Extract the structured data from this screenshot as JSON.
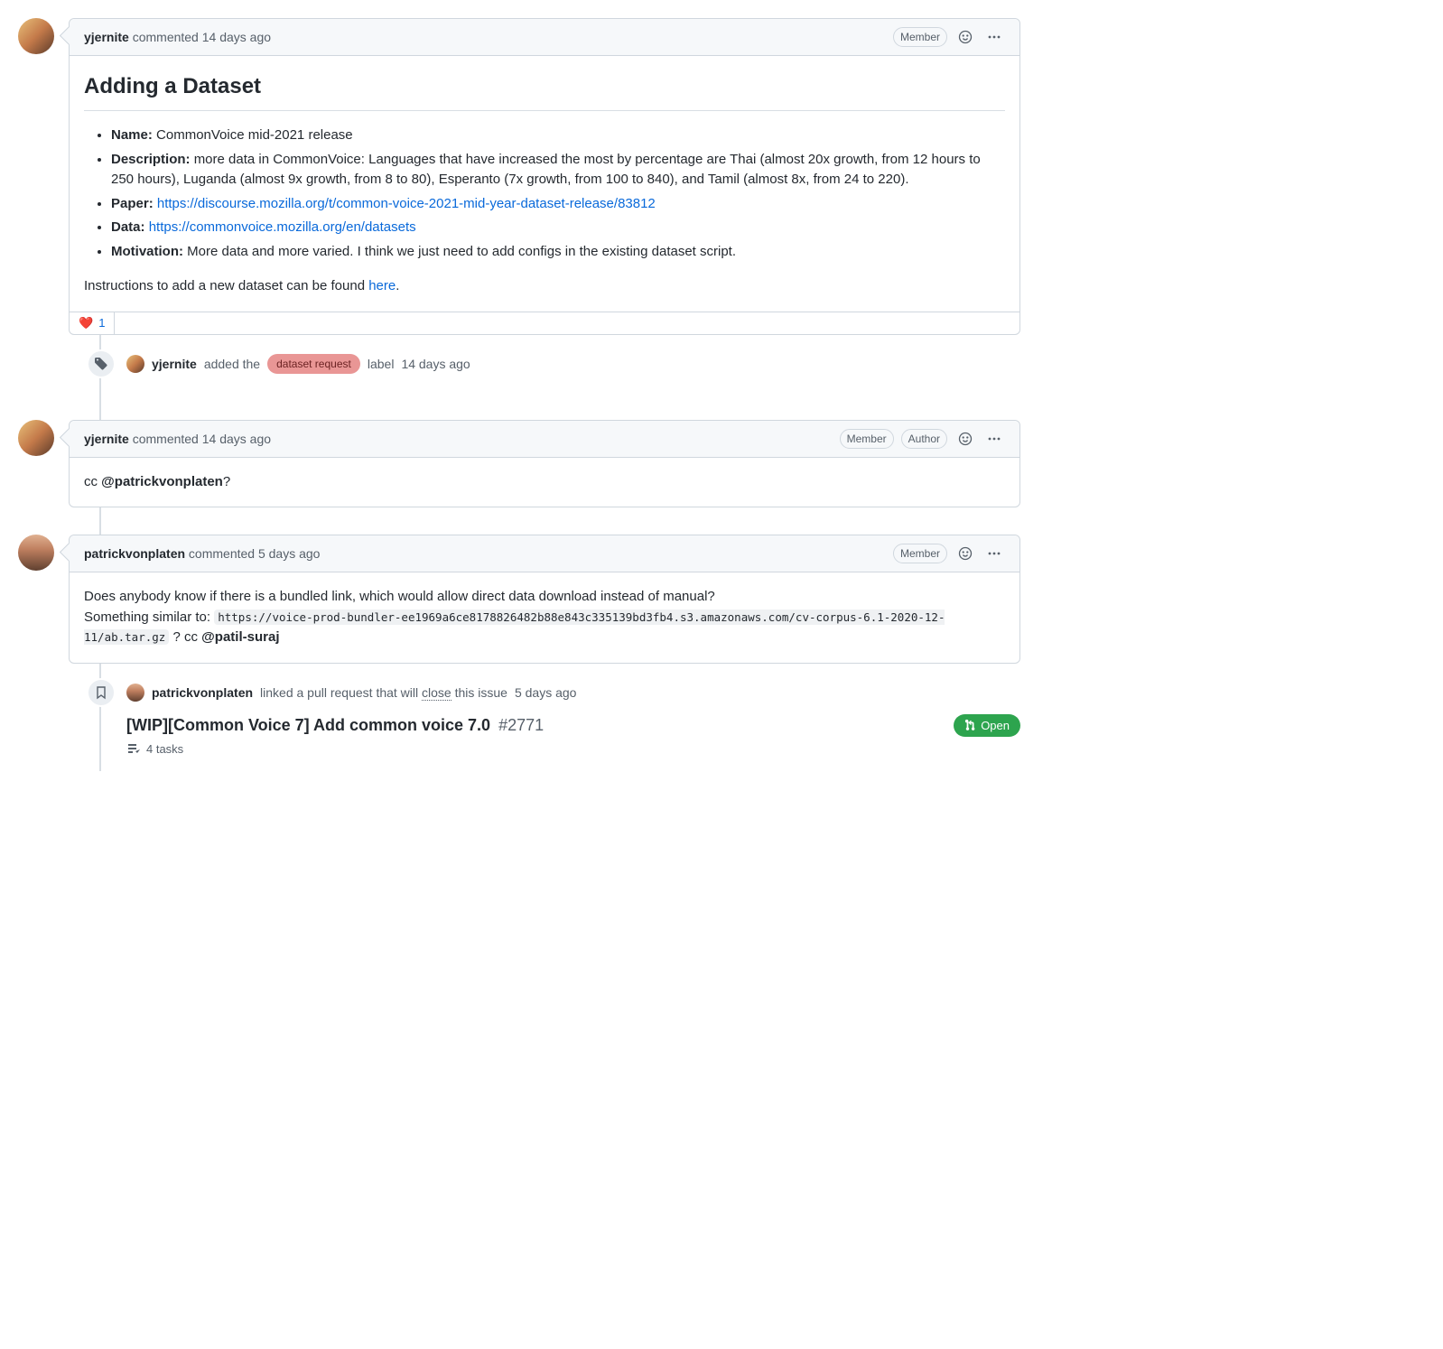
{
  "comments": [
    {
      "author": "yjernite",
      "action": "commented",
      "time": "14 days ago",
      "badges": [
        "Member"
      ],
      "body": {
        "heading": "Adding a Dataset",
        "bullets": {
          "name_label": "Name:",
          "name_value": "CommonVoice mid-2021 release",
          "desc_label": "Description:",
          "desc_value": "more data in CommonVoice: Languages that have increased the most by percentage are Thai (almost 20x growth, from 12 hours to 250 hours), Luganda (almost 9x growth, from 8 to 80), Esperanto (7x growth, from 100 to 840), and Tamil (almost 8x, from 24 to 220).",
          "paper_label": "Paper:",
          "paper_link": "https://discourse.mozilla.org/t/common-voice-2021-mid-year-dataset-release/83812",
          "data_label": "Data:",
          "data_link": "https://commonvoice.mozilla.org/en/datasets",
          "motivation_label": "Motivation:",
          "motivation_value": "More data and more varied. I think we just need to add configs in the existing dataset script."
        },
        "instructions_prefix": "Instructions to add a new dataset can be found ",
        "instructions_link_text": "here",
        "instructions_suffix": "."
      },
      "reaction": {
        "emoji": "❤️",
        "count": "1"
      }
    },
    {
      "author": "yjernite",
      "action": "commented",
      "time": "14 days ago",
      "badges": [
        "Member",
        "Author"
      ],
      "body_text_prefix": "cc ",
      "body_mention": "@patrickvonplaten",
      "body_text_suffix": "?"
    },
    {
      "author": "patrickvonplaten",
      "action": "commented",
      "time": "5 days ago",
      "badges": [
        "Member"
      ],
      "body_line1": "Does anybody know if there is a bundled link, which would allow direct data download instead of manual?",
      "body_line2_prefix": "Something similar to: ",
      "body_code": "https://voice-prod-bundler-ee1969a6ce8178826482b88e843c335139bd3fb4.s3.amazonaws.com/cv-corpus-6.1-2020-12-11/ab.tar.gz",
      "body_line2_mid": " ? cc ",
      "body_mention": "@patil-suraj"
    }
  ],
  "label_event": {
    "author": "yjernite",
    "action_prefix": "added the",
    "label": "dataset request",
    "action_suffix": "label",
    "time": "14 days ago"
  },
  "pr_event": {
    "author": "patrickvonplaten",
    "action_text": "linked a pull request that will ",
    "close_word": "close",
    "action_text2": " this issue",
    "time": "5 days ago",
    "pr_title": "[WIP][Common Voice 7] Add common voice 7.0",
    "pr_number": "#2771",
    "state": "Open",
    "tasks": "4 tasks"
  }
}
